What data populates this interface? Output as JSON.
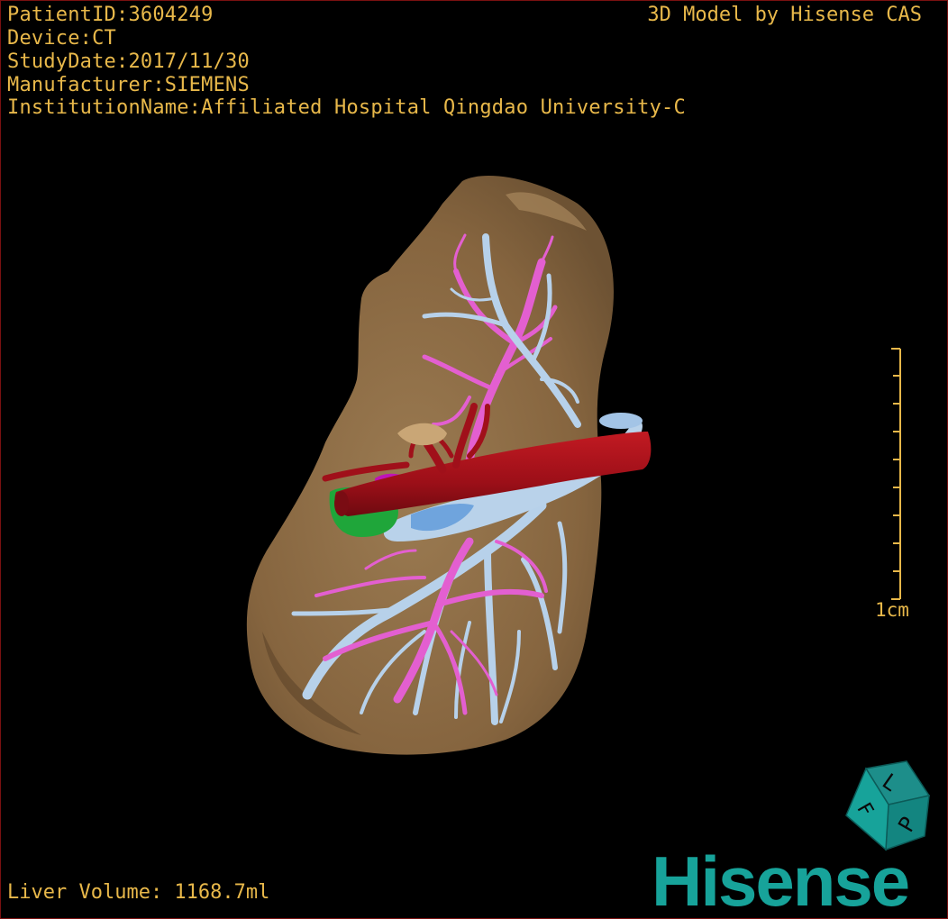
{
  "header": {
    "patient_id": "PatientID:3604249",
    "device": "Device:CT",
    "study_date": "StudyDate:2017/11/30",
    "manufacturer": "Manufacturer:SIEMENS",
    "institution": "InstitutionName:Affiliated Hospital Qingdao University-C"
  },
  "brand_top": "3D Model by Hisense CAS",
  "scale": {
    "label": "1cm"
  },
  "orientation_cube": {
    "icon": "orientation-cube-icon",
    "face_top": "L",
    "face_right": "P",
    "face_left": "F"
  },
  "footer": {
    "liver_volume": "Liver Volume: 1168.7ml"
  },
  "logo": {
    "text": "Hisense"
  },
  "colors": {
    "text": "#e8b84a",
    "liver": "#8a6a43",
    "portal_vein": "#b7d1ea",
    "hepatic_vein": "#e35fd0",
    "artery": "#a0101a",
    "gallbladder": "#1fa63a",
    "logo": "#17a39a"
  }
}
